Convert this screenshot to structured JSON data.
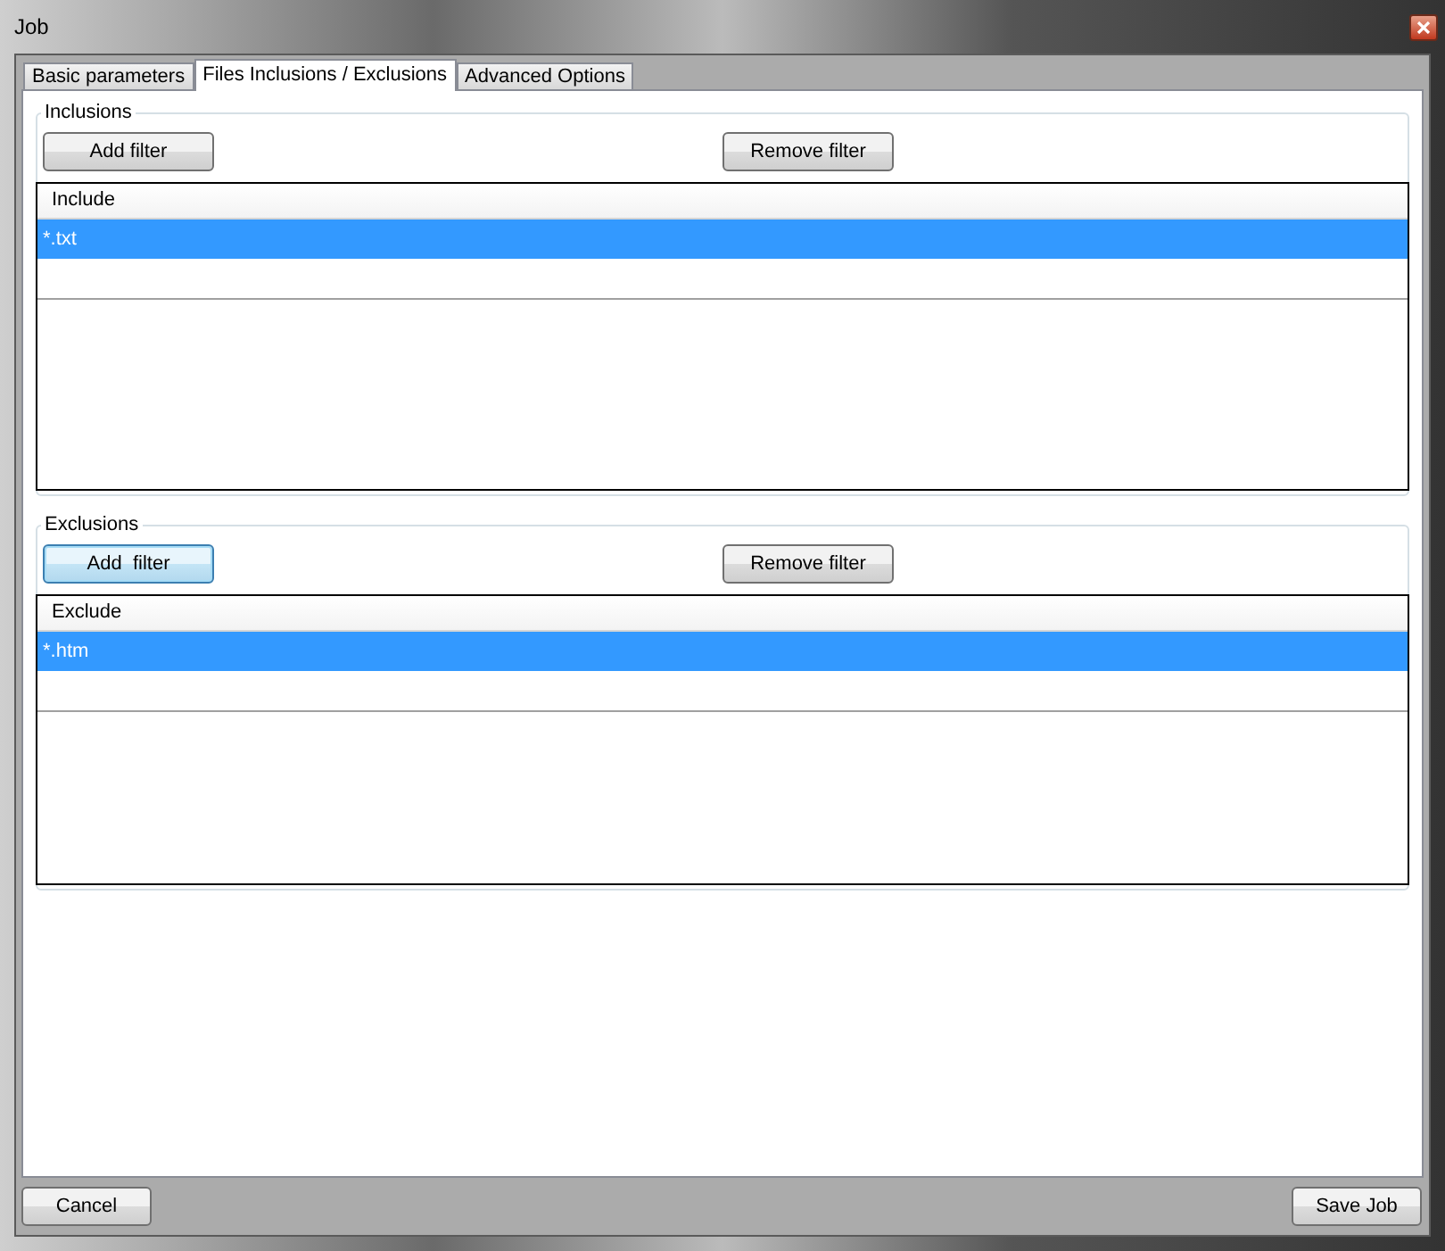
{
  "window": {
    "title": "Job"
  },
  "tabs": [
    {
      "label": "Basic parameters",
      "selected": false
    },
    {
      "label": "Files Inclusions / Exclusions",
      "selected": true
    },
    {
      "label": "Advanced Options",
      "selected": false
    }
  ],
  "groups": [
    {
      "title": "Inclusions",
      "buttons": [
        {
          "label": "Add filter",
          "focused": false
        },
        {
          "label": "Remove filter",
          "focused": false
        }
      ],
      "list": {
        "column": "Include",
        "rows": [
          {
            "text": "*.txt",
            "selected": true
          }
        ]
      }
    },
    {
      "title": "Exclusions",
      "buttons": [
        {
          "label": "Add  filter",
          "focused": true
        },
        {
          "label": "Remove filter",
          "focused": false
        }
      ],
      "list": {
        "column": "Exclude",
        "rows": [
          {
            "text": "*.htm",
            "selected": true
          }
        ]
      }
    }
  ],
  "footer_buttons": [
    "Cancel",
    "Save Job"
  ]
}
